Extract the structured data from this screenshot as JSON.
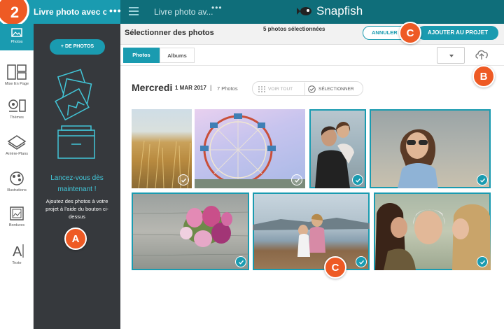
{
  "step_number": "2",
  "topbar": {
    "project_title": "Livre photo avec couvert...",
    "menu_dots": "•••",
    "center_title": "Livre photo av...",
    "center_dots": "•••",
    "logo_text": "Snapfish"
  },
  "toolbar": {
    "items": [
      {
        "label": "Photos",
        "icon": "photos-icon",
        "active": true
      },
      {
        "label": "Mise En Page",
        "icon": "layout-icon"
      },
      {
        "label": "Thèmes",
        "icon": "themes-icon"
      },
      {
        "label": "Arrière-Plans",
        "icon": "backgrounds-icon"
      },
      {
        "label": "Illustrations",
        "icon": "illustrations-icon"
      },
      {
        "label": "Bordures",
        "icon": "borders-icon"
      },
      {
        "label": "Texte",
        "icon": "text-icon"
      }
    ]
  },
  "panel": {
    "add_photos_label": "+ DE PHOTOS",
    "heading": "Lancez-vous dès maintenant !",
    "text": "Ajoutez des photos à votre projet à l'aide du bouton ci-dessus"
  },
  "header": {
    "title": "Sélectionner des photos",
    "selected_count": "5 photos sélectionnées",
    "cancel_label": "ANNULER",
    "add_label": "AJOUTER AU PROJET"
  },
  "tabs": {
    "photos": "Photos",
    "albums": "Albums"
  },
  "date_group": {
    "day": "Mercredi",
    "date": "1 MAR 2017",
    "separator": "|",
    "count": "7 Photos",
    "view_all": "VOIR TOUT",
    "select": "SÉLECTIONNER"
  },
  "callouts": {
    "a": "A",
    "b": "B",
    "c_top": "C",
    "c_bottom": "C"
  },
  "photos": [
    {
      "name": "photo-grass",
      "selected": false
    },
    {
      "name": "photo-ferris-wheel",
      "selected": false
    },
    {
      "name": "photo-father-daughter",
      "selected": true
    },
    {
      "name": "photo-girl-sunglasses",
      "selected": true
    },
    {
      "name": "photo-flowers",
      "selected": true
    },
    {
      "name": "photo-kids-dock",
      "selected": true
    },
    {
      "name": "photo-women-kiss",
      "selected": true
    }
  ],
  "colors": {
    "accent": "#1a9bb0",
    "topbar": "#0f6e7a",
    "panel": "#36393d",
    "callout": "#ee5a24"
  }
}
